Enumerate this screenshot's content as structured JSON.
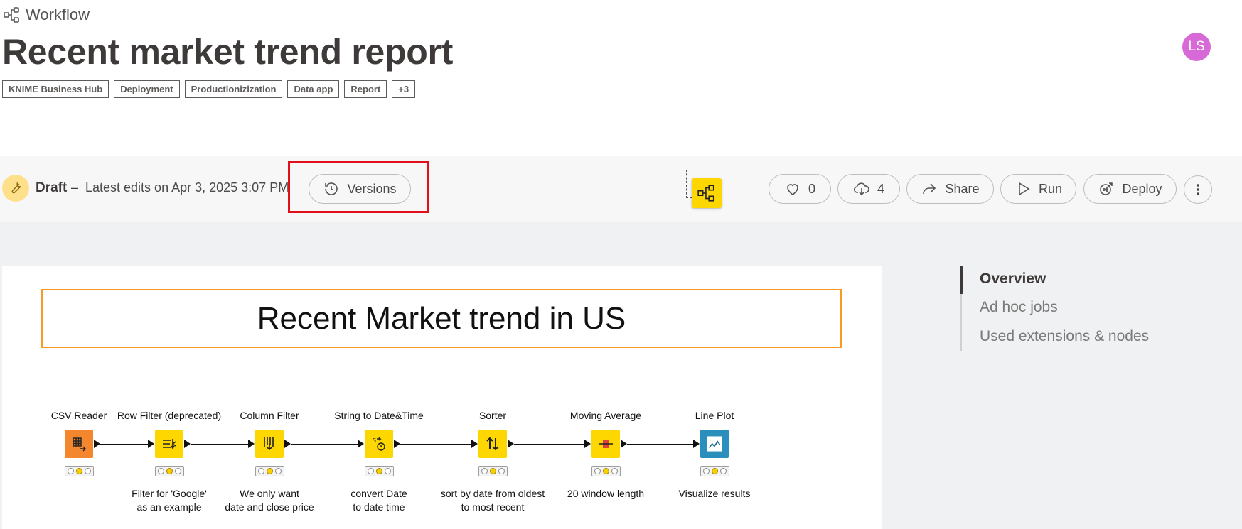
{
  "breadcrumb": {
    "icon": "workflow-icon",
    "label": "Workflow"
  },
  "page_title": "Recent market trend report",
  "tags": [
    "KNIME Business Hub",
    "Deployment",
    "Productionizization",
    "Data app",
    "Report",
    "+3"
  ],
  "user": {
    "initials": "LS",
    "avatar_color": "#d76ad6"
  },
  "status": {
    "state": "Draft",
    "separator": "–",
    "latest_edits": "Latest edits on Apr 3, 2025 3:07 PM",
    "versions_label": "Versions"
  },
  "actions": {
    "likes": "0",
    "downloads": "4",
    "share": "Share",
    "run": "Run",
    "deploy": "Deploy"
  },
  "workflow": {
    "annotation": "Recent Market trend in US",
    "nodes": [
      {
        "title": "CSV Reader",
        "desc1": "",
        "desc2": "",
        "color": "#f4872d",
        "icon": "csv-reader-icon"
      },
      {
        "title": "Row Filter (deprecated)",
        "desc1": "Filter for 'Google'",
        "desc2": "as an example",
        "color": "#ffd700",
        "icon": "row-filter-icon"
      },
      {
        "title": "Column Filter",
        "desc1": "We only want",
        "desc2": "date and close price",
        "color": "#ffd700",
        "icon": "column-filter-icon"
      },
      {
        "title": "String to Date&Time",
        "desc1": "convert Date",
        "desc2": "to date time",
        "color": "#ffd700",
        "icon": "string-to-date-icon"
      },
      {
        "title": "Sorter",
        "desc1": "sort by date from oldest",
        "desc2": "to most recent",
        "color": "#ffd700",
        "icon": "sorter-icon"
      },
      {
        "title": "Moving Average",
        "desc1": "20 window length",
        "desc2": "",
        "color": "#ffd700",
        "icon": "moving-average-icon"
      },
      {
        "title": "Line Plot",
        "desc1": "Visualize results",
        "desc2": "",
        "color": "#2a8fbd",
        "icon": "line-plot-icon"
      }
    ]
  },
  "side_nav": {
    "items": [
      "Overview",
      "Ad hoc jobs",
      "Used extensions & nodes"
    ],
    "active": "Overview"
  },
  "colors": {
    "accent_yellow": "#ffd700",
    "highlight_red": "#e3101c",
    "annotation_border": "#f79b25"
  }
}
